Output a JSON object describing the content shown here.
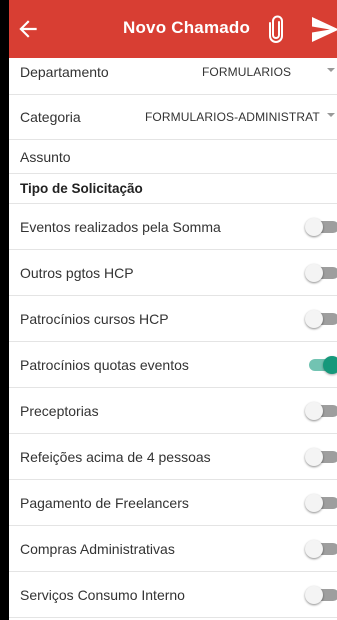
{
  "appbar": {
    "title": "Novo Chamado",
    "back_icon": "arrow-left-icon",
    "attach_icon": "paperclip-icon",
    "send_icon": "send-icon",
    "color": "#d83e33"
  },
  "form": {
    "departamento": {
      "label": "Departamento",
      "value": "FORMULARIOS"
    },
    "categoria": {
      "label": "Categoria",
      "value": "FORMULARIOS-ADMINISTRAT"
    },
    "assunto": {
      "label": "Assunto"
    }
  },
  "section": {
    "title": "Tipo de Solicitação"
  },
  "toggles": [
    {
      "label": "Eventos realizados pela Somma",
      "on": false
    },
    {
      "label": "Outros pgtos HCP",
      "on": false
    },
    {
      "label": "Patrocínios cursos HCP",
      "on": false
    },
    {
      "label": "Patrocínios quotas eventos",
      "on": true
    },
    {
      "label": "Preceptorias",
      "on": false
    },
    {
      "label": "Refeições acima de 4 pessoas",
      "on": false
    },
    {
      "label": "Pagamento de Freelancers",
      "on": false
    },
    {
      "label": "Compras Administrativas",
      "on": false
    },
    {
      "label": "Serviços Consumo Interno",
      "on": false
    }
  ],
  "colors": {
    "switch_on": "#16987b",
    "switch_on_track": "#72c3b2",
    "switch_off_track": "#9e9e9e"
  }
}
